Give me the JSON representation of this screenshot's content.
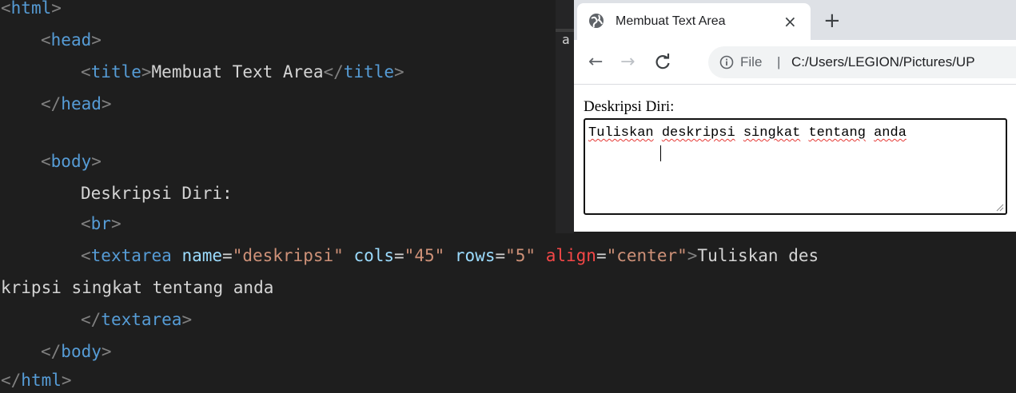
{
  "editor": {
    "lines": [
      {
        "indent": 0,
        "parts": [
          [
            "punct",
            "<"
          ],
          [
            "tag",
            "html"
          ],
          [
            "punct",
            ">"
          ]
        ]
      },
      {
        "indent": 1,
        "parts": [
          [
            "punct",
            "<"
          ],
          [
            "tag",
            "head"
          ],
          [
            "punct",
            ">"
          ]
        ]
      },
      {
        "indent": 2,
        "parts": [
          [
            "punct",
            "<"
          ],
          [
            "tag",
            "title"
          ],
          [
            "punct",
            ">"
          ],
          [
            "txt",
            "Membuat Text Area"
          ],
          [
            "punct",
            "</"
          ],
          [
            "tag",
            "title"
          ],
          [
            "punct",
            ">"
          ]
        ]
      },
      {
        "indent": 1,
        "parts": [
          [
            "punct",
            "</"
          ],
          [
            "tag",
            "head"
          ],
          [
            "punct",
            ">"
          ]
        ]
      },
      {
        "indent": 0,
        "parts": []
      },
      {
        "indent": 1,
        "parts": [
          [
            "punct",
            "<"
          ],
          [
            "tag",
            "body"
          ],
          [
            "punct",
            ">"
          ]
        ]
      },
      {
        "indent": 2,
        "parts": [
          [
            "txt",
            "Deskripsi Diri:"
          ]
        ]
      },
      {
        "indent": 2,
        "parts": [
          [
            "punct",
            "<"
          ],
          [
            "tag",
            "br"
          ],
          [
            "punct",
            ">"
          ]
        ]
      },
      {
        "indent": 2,
        "parts": [
          [
            "punct",
            "<"
          ],
          [
            "tag",
            "textarea"
          ],
          [
            "txt",
            " "
          ],
          [
            "attr",
            "name"
          ],
          [
            "eq",
            "="
          ],
          [
            "str",
            "\"deskripsi\""
          ],
          [
            "txt",
            " "
          ],
          [
            "attr",
            "cols"
          ],
          [
            "eq",
            "="
          ],
          [
            "str",
            "\"45\""
          ],
          [
            "txt",
            " "
          ],
          [
            "attr",
            "rows"
          ],
          [
            "eq",
            "="
          ],
          [
            "str",
            "\"5\""
          ],
          [
            "txt",
            " "
          ],
          [
            "attr-red",
            "align"
          ],
          [
            "eq",
            "="
          ],
          [
            "str",
            "\"center\""
          ],
          [
            "punct",
            ">"
          ],
          [
            "txt",
            "Tuliskan des"
          ]
        ]
      },
      {
        "indent": 0,
        "parts": [
          [
            "txt",
            "kripsi singkat tentang anda"
          ]
        ]
      },
      {
        "indent": 2,
        "parts": [
          [
            "punct",
            "</"
          ],
          [
            "tag",
            "textarea"
          ],
          [
            "punct",
            ">"
          ]
        ]
      },
      {
        "indent": 1,
        "parts": [
          [
            "punct",
            "</"
          ],
          [
            "tag",
            "body"
          ],
          [
            "punct",
            ">"
          ]
        ]
      },
      {
        "indent": 0,
        "parts": [
          [
            "punct",
            "</"
          ],
          [
            "tag",
            "html"
          ],
          [
            "punct",
            ">"
          ]
        ]
      }
    ],
    "stray_char": "a"
  },
  "browser": {
    "tab_title": "Membuat Text Area",
    "tab_close": "×",
    "new_tab": "+",
    "nav_back": "←",
    "nav_forward": "→",
    "nav_reload": "C",
    "omnibox_label": "File",
    "omnibox_separator": "|",
    "omnibox_url": "C:/Users/LEGION/Pictures/UP",
    "page_label": "Deskripsi Diri:",
    "textarea_words": [
      "Tuliskan",
      "deskripsi",
      "singkat",
      "tentang",
      "anda"
    ]
  },
  "colors": {
    "editor_bg": "#1e1e1e",
    "tag": "#569cd6",
    "attribute": "#9cdcfe",
    "string": "#ce9178",
    "warning_attribute": "#f44747",
    "spellcheck": "#e53935"
  }
}
